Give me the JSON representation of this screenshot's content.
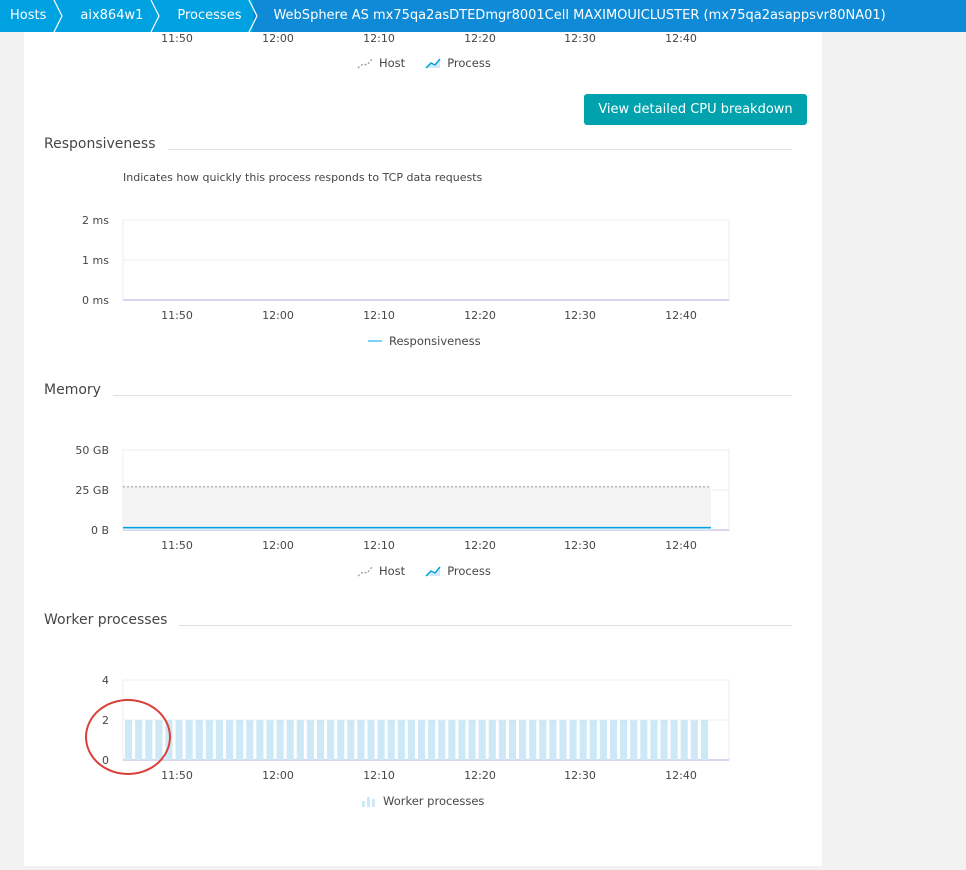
{
  "breadcrumb": {
    "items": [
      "Hosts",
      "aix864w1",
      "Processes"
    ],
    "current": "WebSphere AS mx75qa2asDTEDmgr8001Cell MAXIMOUICLUSTER (mx75qa2asappsvr80NA01)"
  },
  "cpu": {
    "x_ticks": [
      "11:50",
      "12:00",
      "12:10",
      "12:20",
      "12:30",
      "12:40"
    ],
    "legend": {
      "host": "Host",
      "process": "Process"
    },
    "button_label": "View detailed CPU breakdown"
  },
  "responsiveness": {
    "title": "Responsiveness",
    "description": "Indicates how quickly this process responds to TCP data requests",
    "chart_data": {
      "type": "line",
      "y_ticks": [
        "2 ms",
        "1 ms",
        "0 ms"
      ],
      "ylim": [
        0,
        2
      ],
      "x_ticks": [
        "11:50",
        "12:00",
        "12:10",
        "12:20",
        "12:30",
        "12:40"
      ],
      "series": [
        {
          "name": "Responsiveness",
          "values": []
        }
      ],
      "legend_label": "Responsiveness",
      "color": "#4fc3f7"
    }
  },
  "memory": {
    "title": "Memory",
    "chart_data": {
      "type": "area",
      "y_ticks": [
        "50 GB",
        "25 GB",
        "0 B"
      ],
      "ylim": [
        0,
        50
      ],
      "x_ticks": [
        "11:50",
        "12:00",
        "12:10",
        "12:20",
        "12:30",
        "12:40"
      ],
      "series": [
        {
          "name": "Host",
          "value": 27,
          "color": "#b0b0b0"
        },
        {
          "name": "Process",
          "value": 1.5,
          "color": "#00a1e0"
        }
      ],
      "legend": {
        "host": "Host",
        "process": "Process"
      }
    }
  },
  "workers": {
    "title": "Worker processes",
    "chart_data": {
      "type": "bar",
      "y_ticks": [
        "4",
        "2",
        "0"
      ],
      "ylim": [
        0,
        4
      ],
      "x_ticks": [
        "11:50",
        "12:00",
        "12:10",
        "12:20",
        "12:30",
        "12:40"
      ],
      "bar_count": 58,
      "value": 2,
      "series": [
        {
          "name": "Worker processes"
        }
      ],
      "legend_label": "Worker processes",
      "color": "#cde9f7"
    }
  }
}
